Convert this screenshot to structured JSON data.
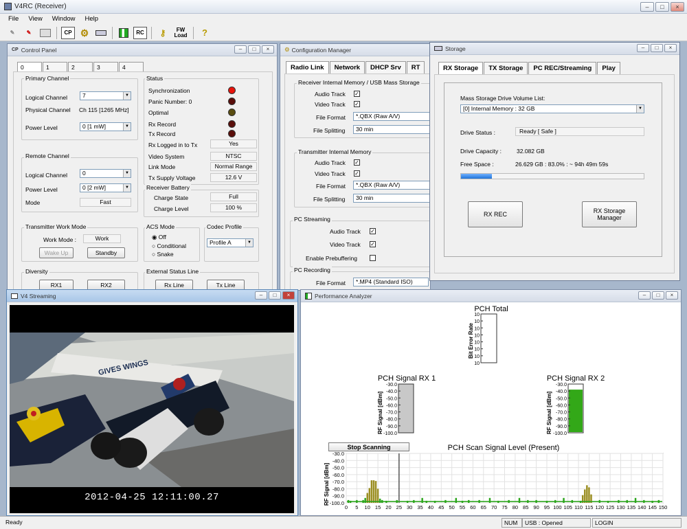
{
  "app": {
    "title": "V4RC  (Receiver)",
    "menus": [
      "File",
      "View",
      "Window",
      "Help"
    ],
    "toolbar": {
      "cp": "CP",
      "rc": "RC",
      "fw1": "FW",
      "fw2": "Load"
    }
  },
  "control": {
    "title": "Control Panel",
    "tabs": [
      "0",
      "1",
      "2",
      "3",
      "4"
    ],
    "primary": {
      "title": "Primary Channel",
      "logical_label": "Logical Channel",
      "logical_value": "7",
      "physical_label": "Physical Channel",
      "physical_value": "Ch 115 [1265 MHz]",
      "power_label": "Power Level",
      "power_value": "0  [1 mW]"
    },
    "remote": {
      "title": "Remote Channel",
      "logical_label": "Logical Channel",
      "logical_value": "0",
      "power_label": "Power Level",
      "power_value": "0  [2 mW]",
      "mode_label": "Mode",
      "mode_value": "Fast"
    },
    "status": {
      "title": "Status",
      "sync": "Synchronization",
      "panic": "Panic Number: 0",
      "optimal": "Optimal",
      "rx_record": "Rx Record",
      "tx_record": "Tx Record",
      "rx_logged": "Rx Logged in to Tx",
      "rx_logged_value": "Yes",
      "video_system": "Video System",
      "video_system_value": "NTSC",
      "link_mode": "Link Mode",
      "link_mode_value": "Normal Range",
      "tx_supply": "Tx Supply Voltage",
      "tx_supply_value": "12.6 V",
      "led_colors": {
        "sync": "#e8140c",
        "panic": "#5a0e0a",
        "optimal": "#5a4d10",
        "rx_record": "#5a0e0a",
        "tx_record": "#5a0e0a"
      }
    },
    "battery": {
      "title": "Receiver Battery",
      "charge_state": "Charge State",
      "charge_state_value": "Full",
      "charge_level": "Charge Level",
      "charge_level_value": "100 %"
    },
    "twm": {
      "title": "Transmitter Work Mode",
      "work_mode_label": "Work Mode :",
      "work_mode_value": "Work",
      "wake_up": "Wake Up",
      "standby": "Standby"
    },
    "acs": {
      "title": "ACS Mode",
      "options": [
        "Off",
        "Conditional",
        "Snake"
      ],
      "selected": "Off"
    },
    "codec": {
      "title": "Codec Profile",
      "value": "Profile A"
    },
    "diversity": {
      "title": "Diversity",
      "rx1": "RX1",
      "rx2": "RX2"
    },
    "ext": {
      "title": "External Status Line",
      "rx": "Rx Line",
      "tx": "Tx Line"
    }
  },
  "config": {
    "title": "Configuration Manager",
    "tabs": [
      "Radio Link",
      "Network",
      "DHCP Srv",
      "RT"
    ],
    "recv": {
      "title": "Receiver Internal Memory / USB Mass Storage",
      "audio": "Audio Track",
      "video": "Video Track",
      "format_label": "File Format",
      "format_value": "*.QBX (Raw A/V)",
      "split_label": "File Splitting",
      "split_value": "30 min"
    },
    "tx": {
      "title": "Transmitter Internal Memory",
      "audio": "Audio Track",
      "video": "Video Track",
      "format_label": "File Format",
      "format_value": "*.QBX (Raw A/V)",
      "split_label": "File Splitting",
      "split_value": "30 min"
    },
    "pcs": {
      "title": "PC Streaming",
      "audio": "Audio Track",
      "video": "Video Track",
      "prebuf": "Enable Prebuffering"
    },
    "pcr": {
      "title": "PC Recording",
      "format_label": "File Format",
      "format_value": "*.MP4 (Standard ISO)"
    }
  },
  "storage": {
    "title": "Storage",
    "tabs": [
      "RX Storage",
      "TX Storage",
      "PC REC/Streaming",
      "Play"
    ],
    "volume_list_label": "Mass Storage Drive Volume List:",
    "volume_value": "[0]  Internal Memory   :  32 GB",
    "drive_status_label": "Drive Status :",
    "drive_status_value": "Ready  [ Safe ]",
    "capacity_label": "Drive Capacity :",
    "capacity_value": "32.082 GB",
    "free_label": "Free Space :",
    "free_value": "26.629 GB : 83.0% : ~ 94h 49m 59s",
    "used_fraction": 0.17,
    "rx_rec": "RX REC",
    "manager1": "RX Storage",
    "manager2": "Manager"
  },
  "streaming": {
    "title": "V4 Streaming",
    "timestamp": "2012-04-25  12:11:00.27",
    "banner": "GIVES WINGS"
  },
  "perf": {
    "title": "Performance Analyzer",
    "pch_total": "PCH Total",
    "ber_label": "Bit Error Rate",
    "ber_ticks": [
      "10",
      "10",
      "10",
      "10",
      "10",
      "10",
      "10",
      "10"
    ],
    "rx1_title": "PCH Signal RX 1",
    "rx2_title": "PCH Signal RX 2",
    "rf_label": "RF Signal [dBm]",
    "rf_ticks": [
      "-30.0",
      "-40.0",
      "-50.0",
      "-60.0",
      "-70.0",
      "-80.0",
      "-90.0",
      "-100.0"
    ],
    "rx1_level_dbm": -100,
    "rx2_level_dbm": -38,
    "stop_scanning": "Stop Scanning",
    "scan_title": "PCH Scan Signal Level (Present)",
    "scan_ylabel": "RF Signal [dBm]",
    "scan_yticks": [
      "-30.0",
      "-40.0",
      "-50.0",
      "-60.0",
      "-70.0",
      "-80.0",
      "-90.0",
      "-100.0"
    ],
    "scan_xticks": [
      "0",
      "5",
      "10",
      "15",
      "20",
      "25",
      "30",
      "35",
      "40",
      "45",
      "50",
      "55",
      "60",
      "65",
      "70",
      "75",
      "80",
      "85",
      "90",
      "95",
      "100",
      "105",
      "110",
      "115",
      "120",
      "125",
      "130",
      "135",
      "140",
      "145",
      "150"
    ]
  },
  "chart_data": {
    "type": "bar",
    "title": "PCH Scan Signal Level (Present)",
    "xlabel": "",
    "ylabel": "RF Signal [dBm]",
    "ylim": [
      -100,
      -30
    ],
    "xlim": [
      0,
      150
    ],
    "x": [
      1,
      2,
      5,
      8,
      9,
      10,
      11,
      12,
      13,
      14,
      15,
      16,
      17,
      19,
      24,
      29,
      32,
      36,
      38,
      42,
      47,
      52,
      55,
      58,
      63,
      68,
      72,
      77,
      82,
      86,
      90,
      95,
      99,
      103,
      107,
      111,
      112,
      113,
      114,
      115,
      116,
      120,
      124,
      129,
      133,
      137,
      141,
      145,
      148
    ],
    "values": [
      -96,
      -97,
      -96,
      -96,
      -93,
      -86,
      -79,
      -68,
      -68,
      -69,
      -80,
      -94,
      -96,
      -97,
      -96,
      -97,
      -96,
      -93,
      -97,
      -97,
      -96,
      -93,
      -97,
      -96,
      -96,
      -93,
      -97,
      -96,
      -93,
      -96,
      -96,
      -97,
      -96,
      -93,
      -96,
      -97,
      -89,
      -81,
      -75,
      -78,
      -88,
      -96,
      -97,
      -96,
      -96,
      -93,
      -96,
      -97,
      -96
    ],
    "highlight_color": "#9a8d20",
    "bar_color": "#2ca51c"
  },
  "statusbar": {
    "ready": "Ready",
    "num": "NUM",
    "usb": "USB : Opened",
    "login": "LOGIN"
  }
}
